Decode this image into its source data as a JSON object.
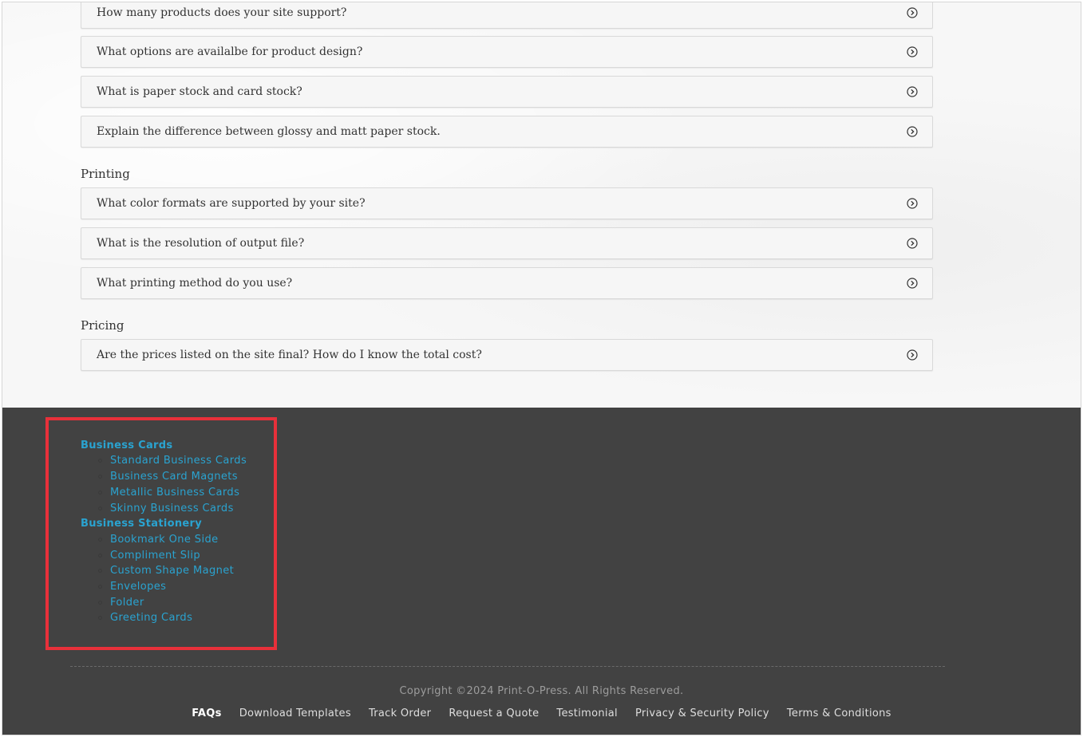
{
  "faq": {
    "design_items": [
      "How many products does your site support?",
      "What options are availalbe for product design?",
      "What is paper stock and card stock?",
      "Explain the difference between glossy and matt paper stock."
    ],
    "printing_heading": "Printing",
    "printing_items": [
      "What color formats are supported by your site?",
      "What is the resolution of output file?",
      "What printing method do you use?"
    ],
    "pricing_heading": "Pricing",
    "pricing_items": [
      "Are the prices listed on the site final? How do I know the total cost?"
    ],
    "expand_icon": "chevron-circle-right-icon"
  },
  "footer": {
    "categories": [
      {
        "label": "Business Cards",
        "items": [
          "Standard Business Cards",
          "Business Card Magnets",
          "Metallic Business Cards",
          "Skinny Business Cards"
        ]
      },
      {
        "label": "Business Stationery",
        "items": [
          "Bookmark One Side",
          "Compliment Slip",
          "Custom Shape Magnet",
          "Envelopes",
          "Folder",
          "Greeting Cards"
        ]
      }
    ],
    "copyright": "Copyright ©2024 Print-O-Press. All Rights Reserved.",
    "nav": [
      "FAQs",
      "Download Templates",
      "Track Order",
      "Request a Quote",
      "Testimonial",
      "Privacy & Security Policy",
      "Terms & Conditions"
    ],
    "active_nav": "FAQs"
  },
  "colors": {
    "link": "#2aa3d0",
    "footer_bg": "#424242",
    "highlight": "#e8303a"
  }
}
